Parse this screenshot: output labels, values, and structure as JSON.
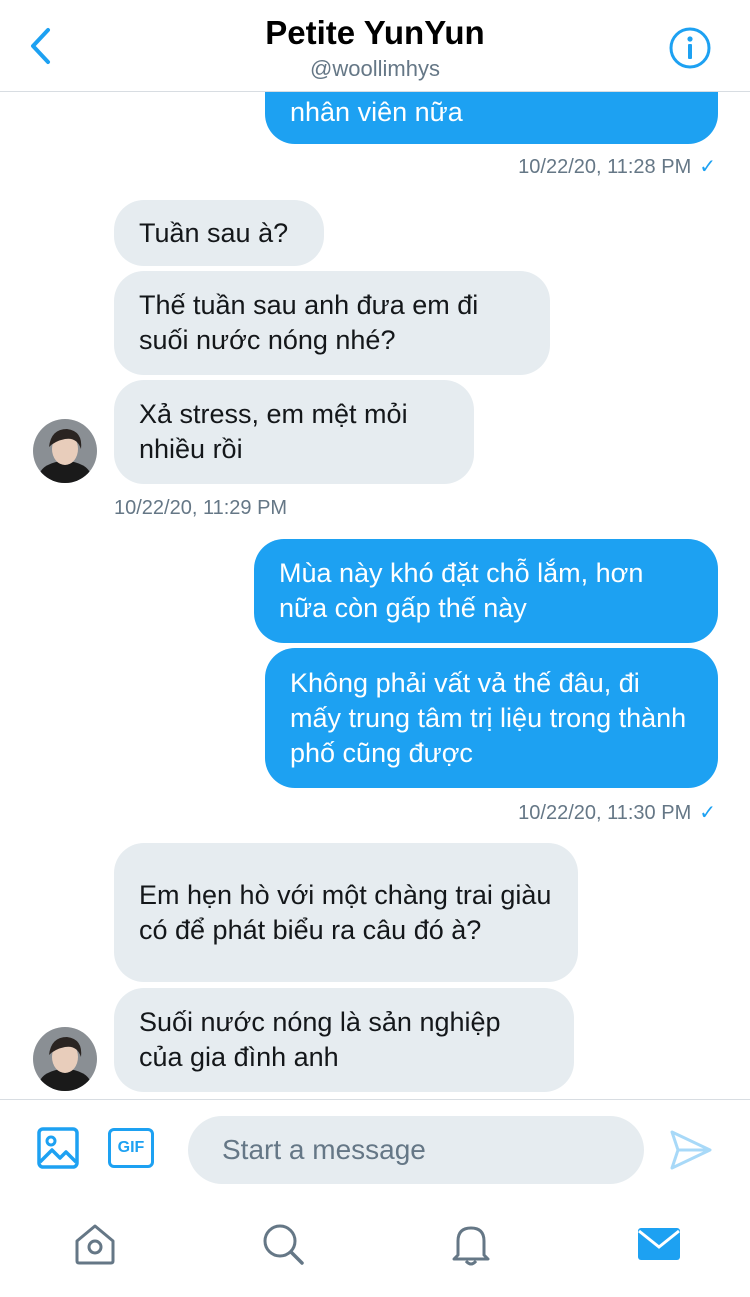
{
  "header": {
    "title": "Petite YunYun",
    "handle": "@woollimhys"
  },
  "messages": [
    {
      "dir": "out",
      "text": "nhân viên nữa"
    },
    {
      "dir": "ts_out",
      "text": "10/22/20, 11:28 PM"
    },
    {
      "dir": "in",
      "text": "Tuần sau à?"
    },
    {
      "dir": "in",
      "text": "Thế tuần sau anh đưa em đi suối nước nóng nhé?"
    },
    {
      "dir": "in",
      "text": "Xả stress, em mệt mỏi nhiều rồi"
    },
    {
      "dir": "ts_in",
      "text": "10/22/20, 11:29 PM"
    },
    {
      "dir": "out",
      "text": "Mùa này khó đặt chỗ lắm, hơn nữa còn gấp thế này"
    },
    {
      "dir": "out",
      "text": "Không phải vất vả thế đâu, đi mấy trung tâm trị liệu trong thành phố cũng được"
    },
    {
      "dir": "ts_out",
      "text": "10/22/20, 11:30 PM"
    },
    {
      "dir": "in",
      "text": "Em hẹn hò với một chàng trai giàu có để phát biểu ra câu đó à?"
    },
    {
      "dir": "in",
      "text": "Suối nước nóng là sản nghiệp của gia đình anh"
    }
  ],
  "composer": {
    "gif_label": "GIF",
    "placeholder": "Start a message"
  },
  "colors": {
    "accent": "#1da1f2",
    "incoming_bubble": "#e6ecf0",
    "secondary_text": "#657786"
  },
  "icons": {
    "back": "chevron-left-icon",
    "info": "info-icon",
    "image": "image-icon",
    "send": "send-icon",
    "home": "home-icon",
    "search": "search-icon",
    "notifications": "bell-icon",
    "messages": "mail-icon"
  }
}
